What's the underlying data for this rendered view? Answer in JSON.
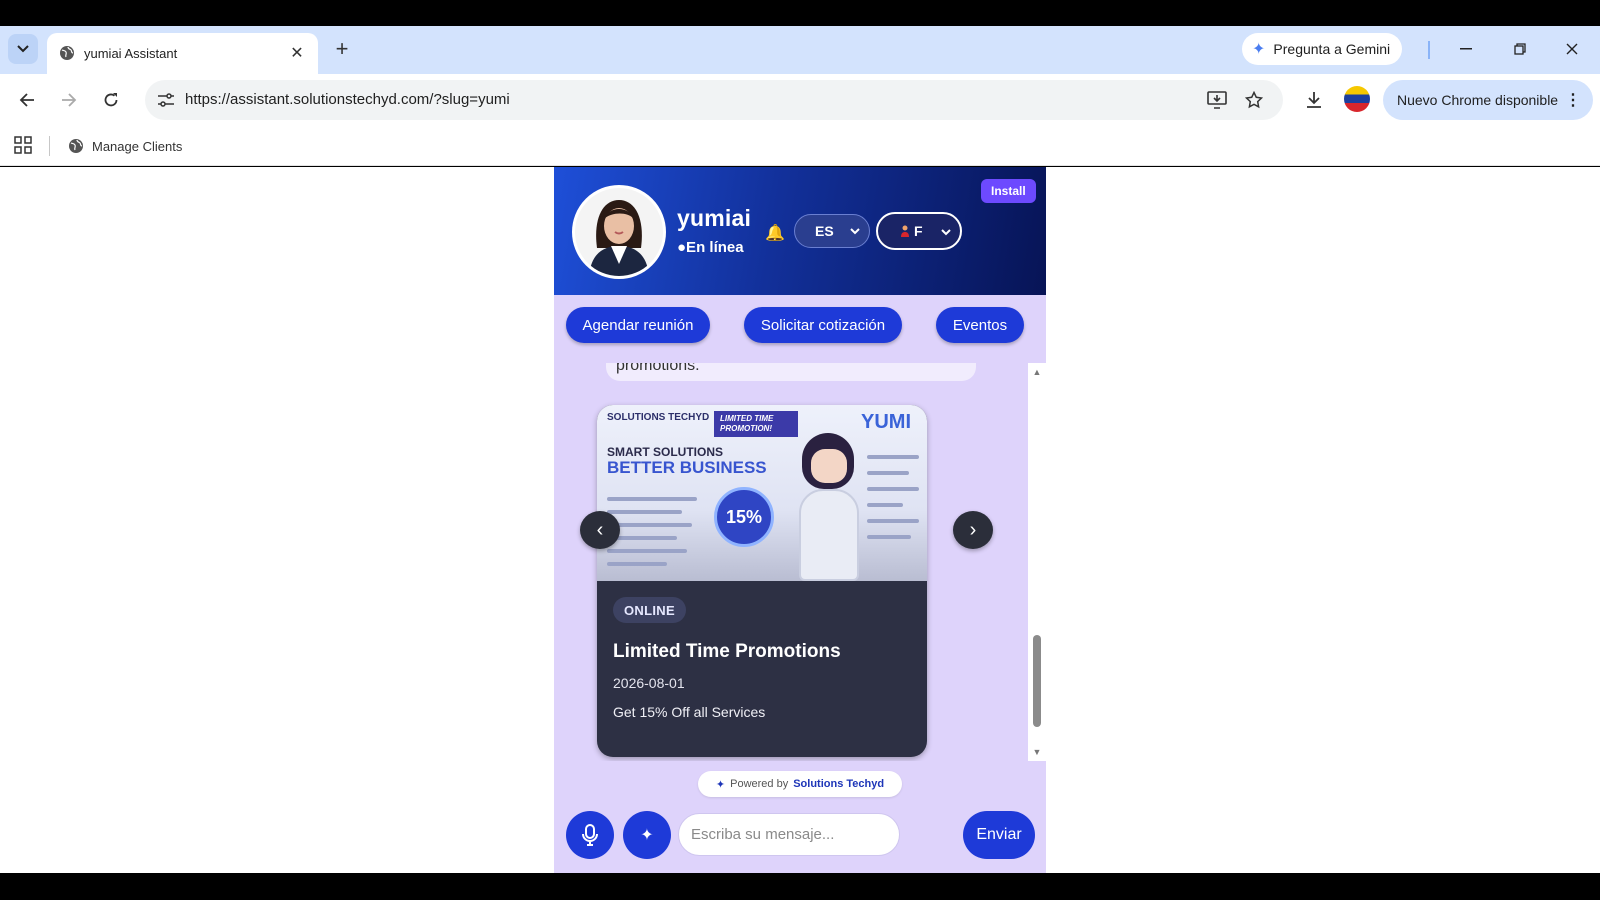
{
  "browser": {
    "tab_title": "yumiai Assistant",
    "gemini_label": "Pregunta a Gemini",
    "url": "https://assistant.solutionstechyd.com/?slug=yumi",
    "update_label": "Nuevo Chrome disponible",
    "bookmark_label": "Manage Clients"
  },
  "header": {
    "bot_name": "yumiai",
    "status": "●En línea",
    "language": "ES",
    "voice": "F",
    "install_label": "Install"
  },
  "quick_actions": [
    "Agendar reunión",
    "Solicitar cotización",
    "Eventos"
  ],
  "chat": {
    "prev_message_tail": "promotions."
  },
  "card": {
    "image": {
      "brand": "SOLUTIONS TECHYD",
      "badge": "LIMITED TIME PROMOTION!",
      "meet": "YUMI",
      "headline1": "SMART SOLUTIONS",
      "headline2": "BETTER BUSINESS",
      "discount": "15%"
    },
    "tag": "ONLINE",
    "title": "Limited Time Promotions",
    "date": "2026-08-01",
    "description": "Get 15% Off all Services"
  },
  "footer": {
    "powered_prefix": "Powered by",
    "powered_brand": "Solutions Techyd",
    "input_placeholder": "Escriba su mensaje...",
    "send_label": "Enviar"
  },
  "colors": {
    "accent": "#1e3ad8",
    "widget_bg": "#ded3fb",
    "install": "#6d4aff"
  }
}
